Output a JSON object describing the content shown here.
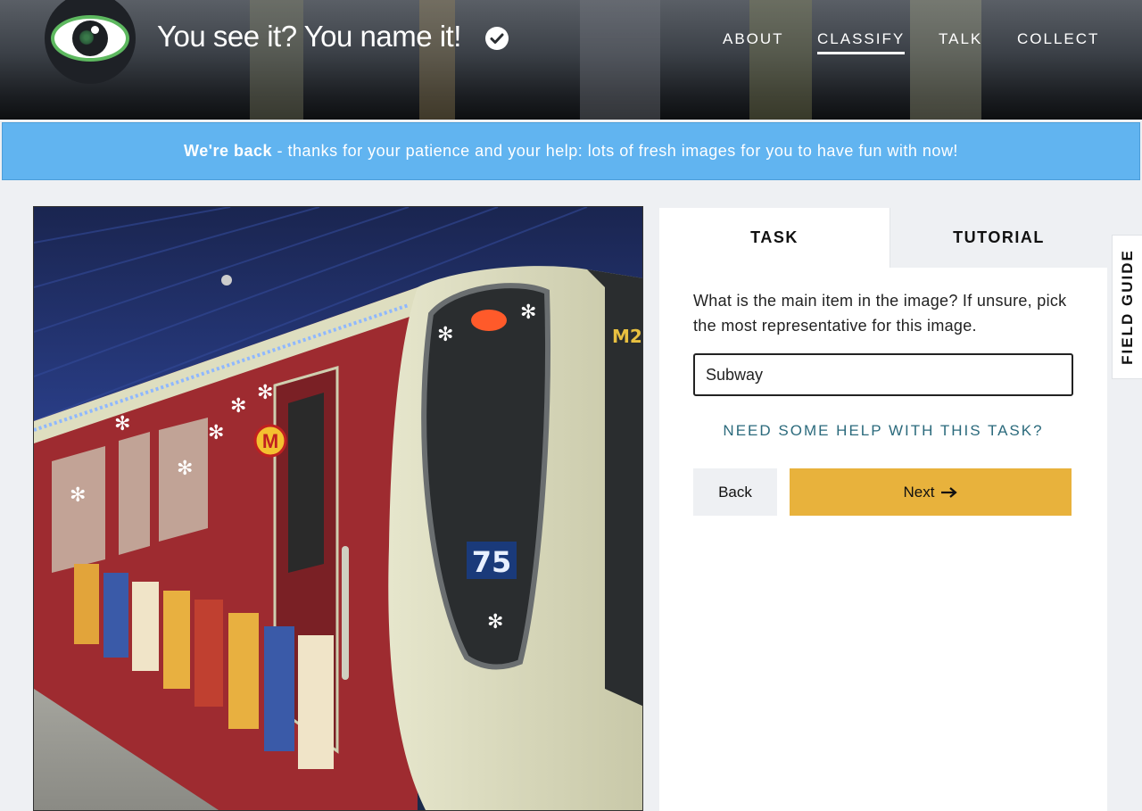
{
  "header": {
    "site_title": "You see it? You name it!",
    "nav": {
      "about": "ABOUT",
      "classify": "CLASSIFY",
      "talk": "TALK",
      "collect": "COLLECT"
    },
    "active_nav": "CLASSIFY"
  },
  "banner": {
    "bold": "We're back",
    "text": " - thanks for your patience and your help: lots of fresh images for you to have fun with now!"
  },
  "subject_image": {
    "car_number": "75",
    "logo_letter": "M",
    "route_label": "M2"
  },
  "task_panel": {
    "tabs": {
      "task": "TASK",
      "tutorial": "TUTORIAL"
    },
    "active_tab": "TASK",
    "question": "What is the main item in the image? If unsure, pick the most representative for this image.",
    "answer_value": "Subway",
    "help_link": "NEED SOME HELP WITH THIS TASK?",
    "back_label": "Back",
    "next_label": "Next"
  },
  "field_guide_label": "FIELD GUIDE",
  "colors": {
    "banner_bg": "#61b4f0",
    "next_button": "#e8b23c",
    "help_link": "#2b6a7c",
    "logo_ring": "#5db85f"
  },
  "icons": {
    "verified": "check-circle-icon",
    "next_arrow": "arrow-right-icon"
  }
}
